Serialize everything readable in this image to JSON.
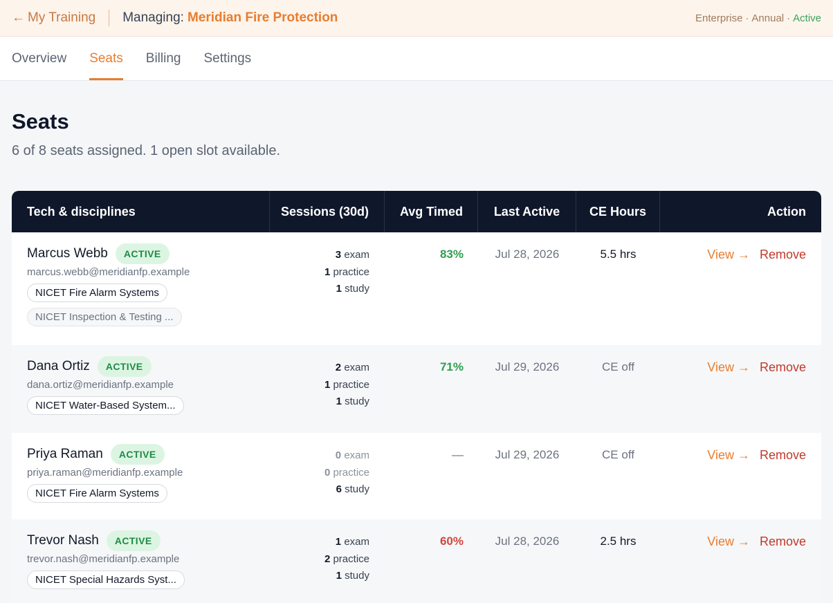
{
  "topbar": {
    "back_arrow": "←",
    "back_label": "My Training",
    "managing_label": "Managing:",
    "org_name": "Meridian Fire Protection",
    "plan": "Enterprise",
    "billing": "Annual",
    "status": "Active",
    "dot": "·"
  },
  "tabs": [
    {
      "label": "Overview"
    },
    {
      "label": "Seats"
    },
    {
      "label": "Billing"
    },
    {
      "label": "Settings"
    }
  ],
  "page": {
    "title": "Seats",
    "subtitle": "6 of 8 seats assigned. 1 open slot available."
  },
  "table": {
    "headers": [
      "Tech & disciplines",
      "Sessions (30d)",
      "Avg Timed",
      "Last Active",
      "CE Hours",
      "Action"
    ],
    "view_label": "View →",
    "remove_label": "Remove",
    "rows": [
      {
        "name": "Marcus Webb",
        "badge": "ACTIVE",
        "email": "marcus.webb@meridianfp.example",
        "chips": [
          "NICET Fire Alarm Systems",
          "NICET Inspection & Testing ..."
        ],
        "exam_n": "3",
        "exam_l": "exam",
        "practice_n": "1",
        "practice_l": "practice",
        "study_n": "1",
        "study_l": "study",
        "avg": "83%",
        "last": "Jul 28, 2026",
        "ce": "5.5 hrs"
      },
      {
        "name": "Dana Ortiz",
        "badge": "ACTIVE",
        "email": "dana.ortiz@meridianfp.example",
        "chips": [
          "NICET Water-Based System..."
        ],
        "exam_n": "2",
        "exam_l": "exam",
        "practice_n": "1",
        "practice_l": "practice",
        "study_n": "1",
        "study_l": "study",
        "avg": "71%",
        "last": "Jul 29, 2026",
        "ce": "CE off"
      },
      {
        "name": "Priya Raman",
        "badge": "ACTIVE",
        "email": "priya.raman@meridianfp.example",
        "chips": [
          "NICET Fire Alarm Systems"
        ],
        "exam_n": "0",
        "exam_l": "exam",
        "practice_n": "0",
        "practice_l": "practice",
        "study_n": "6",
        "study_l": "study",
        "avg": "—",
        "last": "Jul 29, 2026",
        "ce": "CE off"
      },
      {
        "name": "Trevor Nash",
        "badge": "ACTIVE",
        "email": "trevor.nash@meridianfp.example",
        "chips": [
          "NICET Special Hazards Syst..."
        ],
        "exam_n": "1",
        "exam_l": "exam",
        "practice_n": "2",
        "practice_l": "practice",
        "study_n": "1",
        "study_l": "study",
        "avg": "60%",
        "last": "Jul 28, 2026",
        "ce": "2.5 hrs"
      }
    ]
  },
  "colors": {
    "accent": "#e87d2e",
    "header_bg": "#0f172a",
    "active_green": "#2e9e4f",
    "remove_red": "#c0392b"
  }
}
